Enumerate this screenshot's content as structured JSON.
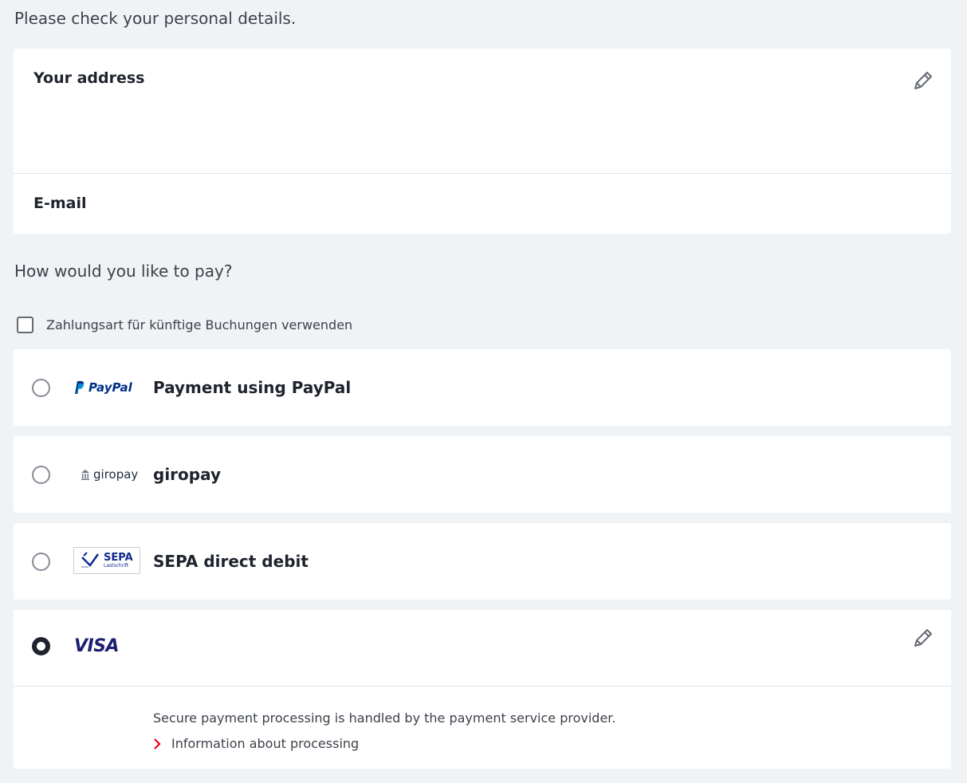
{
  "personal": {
    "heading": "Please check your personal details.",
    "address_title": "Your address",
    "email_title": "E-mail"
  },
  "payment": {
    "heading": "How would you like to pay?",
    "save_checkbox_label": "Zahlungsart für künftige Buchungen verwenden",
    "save_checkbox_checked": false,
    "options": [
      {
        "id": "paypal",
        "label": "Payment using PayPal",
        "logo_text": "PayPal",
        "selected": false
      },
      {
        "id": "giropay",
        "label": "giropay",
        "logo_text": "giropay",
        "selected": false
      },
      {
        "id": "sepa",
        "label": "SEPA direct debit",
        "logo_text": "SEPA",
        "logo_subtext": "Lastschrift",
        "selected": false
      },
      {
        "id": "visa",
        "label": "",
        "logo_text": "VISA",
        "selected": true
      }
    ],
    "visa_info_text": "Secure payment processing is handled by the payment service provider.",
    "visa_info_link": "Information about processing"
  },
  "icons": {
    "edit": "pencil-icon",
    "link_chevron": "chevron-right-icon",
    "sepa": "sepa-logo-icon"
  },
  "colors": {
    "background": "#f0f3f5",
    "card": "#ffffff",
    "text_dark": "#1e232d",
    "paypal_dark": "#003087",
    "paypal_light": "#009cde",
    "visa_blue": "#1a1f71",
    "link_chevron": "#ec0016",
    "sepa_blue": "#10298e"
  }
}
